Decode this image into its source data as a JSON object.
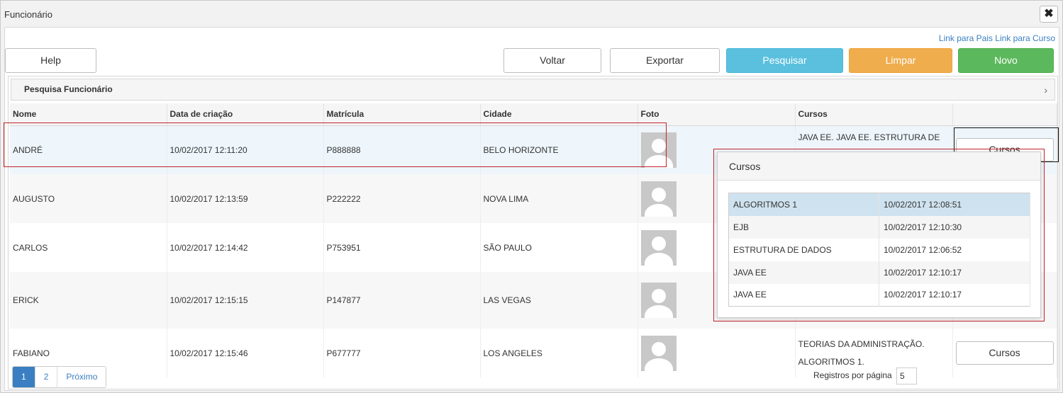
{
  "window": {
    "title": "Funcionário",
    "close_symbol": "✖"
  },
  "links": {
    "pais": "Link para Pais",
    "curso": "Link para Curso"
  },
  "toolbar": {
    "help": "Help",
    "voltar": "Voltar",
    "exportar": "Exportar",
    "pesquisar": "Pesquisar",
    "limpar": "Limpar",
    "novo": "Novo"
  },
  "search_panel": {
    "title": "Pesquisa Funcionário",
    "chevron": "›"
  },
  "columns": [
    "Nome",
    "Data de criação",
    "Matrícula",
    "Cidade",
    "Foto",
    "Cursos"
  ],
  "rows": [
    {
      "nome": "ANDRÉ",
      "data": "10/02/2017 12:11:20",
      "matricula": "P888888",
      "cidade": "BELO HORIZONTE",
      "cursos_text": "JAVA EE. JAVA EE. ESTRUTURA DE",
      "cursos_btn": "Cursos"
    },
    {
      "nome": "AUGUSTO",
      "data": "10/02/2017 12:13:59",
      "matricula": "P222222",
      "cidade": "NOVA LIMA",
      "cursos_text": "",
      "cursos_btn": ""
    },
    {
      "nome": "CARLOS",
      "data": "10/02/2017 12:14:42",
      "matricula": "P753951",
      "cidade": "SÃO PAULO",
      "cursos_text": "",
      "cursos_btn": ""
    },
    {
      "nome": "ERICK",
      "data": "10/02/2017 12:15:15",
      "matricula": "P147877",
      "cidade": "LAS VEGAS",
      "cursos_text": "",
      "cursos_btn": ""
    },
    {
      "nome": "FABIANO",
      "data": "10/02/2017 12:15:46",
      "matricula": "P677777",
      "cidade": "LOS ANGELES",
      "cursos_text_1": "TEORIAS DA ADMINISTRAÇÃO.",
      "cursos_text_2": "ALGORITMOS 1.",
      "cursos_btn": "Cursos"
    }
  ],
  "pager": {
    "p1": "1",
    "p2": "2",
    "next": "Próximo"
  },
  "per_page": {
    "label": "Registros por página",
    "value": "5"
  },
  "popup": {
    "title": "Cursos",
    "items": [
      {
        "nome": "ALGORITMOS 1",
        "data": "10/02/2017 12:08:51"
      },
      {
        "nome": "EJB",
        "data": "10/02/2017 12:10:30"
      },
      {
        "nome": "ESTRUTURA DE DADOS",
        "data": "10/02/2017 12:06:52"
      },
      {
        "nome": "JAVA EE",
        "data": "10/02/2017 12:10:17"
      },
      {
        "nome": "JAVA EE",
        "data": "10/02/2017 12:10:17"
      }
    ]
  },
  "colors": {
    "info": "#5bc0de",
    "warning": "#f0ad4e",
    "success": "#5cb85c",
    "link": "#3a7fc1",
    "highlight": "#c0232c"
  }
}
